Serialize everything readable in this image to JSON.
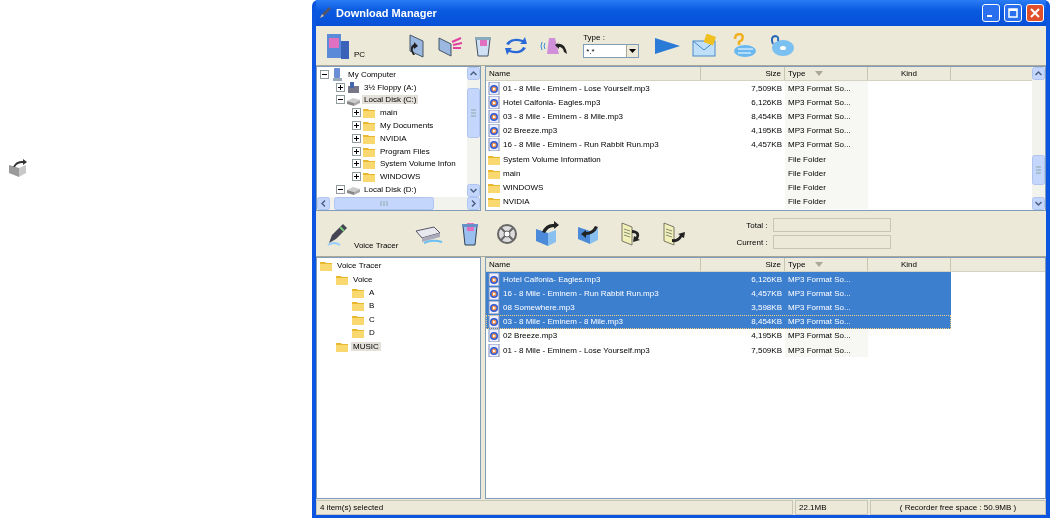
{
  "window": {
    "title": "Download Manager"
  },
  "toolbar": {
    "device_label": "PC",
    "type_label": "Type :",
    "type_value": "*.*"
  },
  "upper_tree": {
    "items": [
      {
        "label": "My Computer",
        "kind": "computer",
        "expanded": true,
        "selected": false,
        "children": [
          {
            "label": "3½ Floppy (A:)",
            "kind": "floppy",
            "expanded": false,
            "selected": false
          },
          {
            "label": "Local Disk (C:)",
            "kind": "disk",
            "expanded": true,
            "selected": true,
            "children": [
              {
                "label": "main",
                "kind": "folder",
                "expanded": false,
                "selected": false
              },
              {
                "label": "My Documents",
                "kind": "folder",
                "expanded": false,
                "selected": false
              },
              {
                "label": "NVIDIA",
                "kind": "folder",
                "expanded": false,
                "selected": false
              },
              {
                "label": "Program Files",
                "kind": "folder",
                "expanded": false,
                "selected": false
              },
              {
                "label": "System Volume Infon",
                "kind": "folder",
                "expanded": false,
                "selected": false
              },
              {
                "label": "WINDOWS",
                "kind": "folder",
                "expanded": false,
                "selected": false
              }
            ]
          },
          {
            "label": "Local Disk (D:)",
            "kind": "disk",
            "expanded": true,
            "selected": false
          }
        ]
      }
    ]
  },
  "upper_list": {
    "columns": [
      {
        "label": "Name",
        "sorted": false
      },
      {
        "label": "Size",
        "sorted": false
      },
      {
        "label": "Type",
        "sorted": true
      },
      {
        "label": "Kind",
        "sorted": false
      }
    ],
    "rows": [
      {
        "name": "01 - 8 Mile - Eminem - Lose Yourself.mp3",
        "size": "7,509KB",
        "type": "MP3 Format So...",
        "kind": "audio",
        "selected": false
      },
      {
        "name": "Hotel Calfonia- Eagles.mp3",
        "size": "6,126KB",
        "type": "MP3 Format So...",
        "kind": "audio",
        "selected": false
      },
      {
        "name": "03 - 8 Mile - Eminem - 8 Mile.mp3",
        "size": "8,454KB",
        "type": "MP3 Format So...",
        "kind": "audio",
        "selected": false
      },
      {
        "name": "02 Breeze.mp3",
        "size": "4,195KB",
        "type": "MP3 Format So...",
        "kind": "audio",
        "selected": false
      },
      {
        "name": "16 - 8 Mile - Eminem - Run Rabbit Run.mp3",
        "size": "4,457KB",
        "type": "MP3 Format So...",
        "kind": "audio",
        "selected": false
      },
      {
        "name": "System Volume Information",
        "type": "File Folder",
        "kind": "folder",
        "selected": false
      },
      {
        "name": "main",
        "type": "File Folder",
        "kind": "folder",
        "selected": false
      },
      {
        "name": "WINDOWS",
        "type": "File Folder",
        "kind": "folder",
        "selected": false
      },
      {
        "name": "NVIDIA",
        "type": "File Folder",
        "kind": "folder",
        "selected": false
      }
    ]
  },
  "voice_toolbar": {
    "device_label": "Voice Tracer",
    "total_label": "Total :",
    "current_label": "Current :"
  },
  "lower_tree": {
    "items": [
      {
        "label": "Voice Tracer",
        "kind": "folder",
        "selected": false,
        "children": [
          {
            "label": "Voice",
            "kind": "folder",
            "selected": false,
            "children": [
              {
                "label": "A",
                "kind": "folder",
                "selected": false
              },
              {
                "label": "B",
                "kind": "folder",
                "selected": false
              },
              {
                "label": "C",
                "kind": "folder",
                "selected": false
              },
              {
                "label": "D",
                "kind": "folder",
                "selected": false
              }
            ]
          },
          {
            "label": "MUSIC",
            "kind": "folder",
            "selected": true
          }
        ]
      }
    ]
  },
  "lower_list": {
    "columns": [
      {
        "label": "Name",
        "sorted": false
      },
      {
        "label": "Size",
        "sorted": false
      },
      {
        "label": "Type",
        "sorted": true
      },
      {
        "label": "Kind",
        "sorted": false
      }
    ],
    "rows": [
      {
        "name": "Hotel Calfonia- Eagles.mp3",
        "size": "6,126KB",
        "type": "MP3 Format So...",
        "kind": "audio",
        "selected": true
      },
      {
        "name": "16 - 8 Mile - Eminem - Run Rabbit Run.mp3",
        "size": "4,457KB",
        "type": "MP3 Format So...",
        "kind": "audio",
        "selected": true
      },
      {
        "name": "08 Somewhere.mp3",
        "size": "3,598KB",
        "type": "MP3 Format So...",
        "kind": "audio",
        "selected": true
      },
      {
        "name": "03 - 8 Mile - Eminem - 8 Mile.mp3",
        "size": "8,454KB",
        "type": "MP3 Format So...",
        "kind": "audio",
        "selected": true
      },
      {
        "name": "02 Breeze.mp3",
        "size": "4,195KB",
        "type": "MP3 Format So...",
        "kind": "audio",
        "selected": false
      },
      {
        "name": "01 - 8 Mile - Eminem - Lose Yourself.mp3",
        "size": "7,509KB",
        "type": "MP3 Format So...",
        "kind": "audio",
        "selected": false
      }
    ]
  },
  "status_bar": {
    "selection": "4 item(s) selected",
    "size": "22.1MB",
    "free_space": "( Recorder free space : 50.9MB )"
  }
}
